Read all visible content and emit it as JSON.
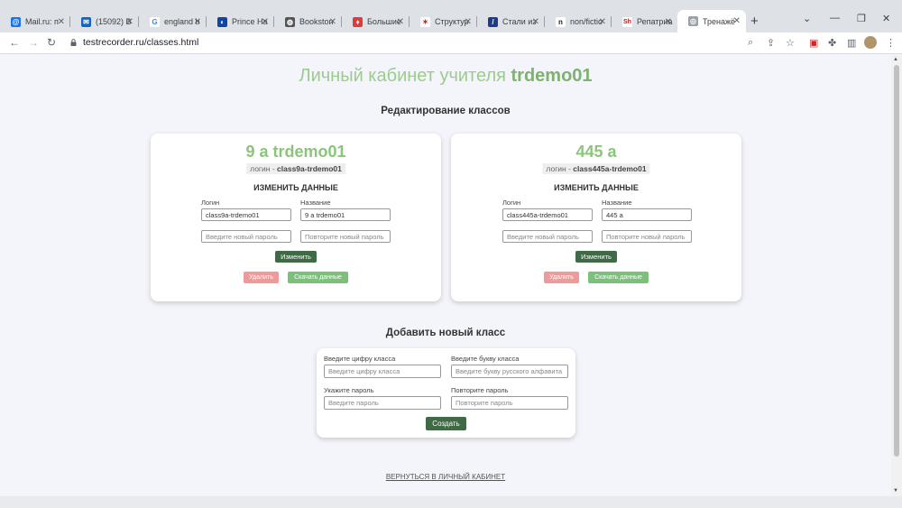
{
  "browser": {
    "tabs": [
      {
        "label": "Mail.ru: п",
        "fav_color": "#1a73e8",
        "fav_char": "@"
      },
      {
        "label": "(15092) В",
        "fav_color": "#1565c0",
        "fav_char": "✉"
      },
      {
        "label": "england b",
        "fav_color": "#ffffff",
        "fav_char": "G"
      },
      {
        "label": "Prince Ha",
        "fav_color": "#0d47a1",
        "fav_char": "◐"
      },
      {
        "label": "Bookston",
        "fav_color": "#555555",
        "fav_char": "◍"
      },
      {
        "label": "Большие",
        "fav_color": "#e53935",
        "fav_char": "♦"
      },
      {
        "label": "Структур",
        "fav_color": "#c62828",
        "fav_char": "✶"
      },
      {
        "label": "Стали из",
        "fav_color": "#1e3a8a",
        "fav_char": "/"
      },
      {
        "label": "non/fictio",
        "fav_color": "#222222",
        "fav_char": "n"
      },
      {
        "label": "Репатриа",
        "fav_color": "#b71c1c",
        "fav_char": "Sh"
      },
      {
        "label": "Тренажё",
        "fav_color": "#9aa0a6",
        "fav_char": "◎"
      }
    ],
    "url": "testrecorder.ru/classes.html"
  },
  "page": {
    "title_prefix": "Личный кабинет учителя",
    "title_user": "trdemo01",
    "edit_heading": "Редактирование классов",
    "add_heading": "Добавить новый класс",
    "back_link": "ВЕРНУТЬСЯ В ЛИЧНЫЙ КАБИНЕТ"
  },
  "classes": [
    {
      "name": "9 а trdemo01",
      "login_prefix": "логин - ",
      "login": "class9a-trdemo01",
      "change_heading": "ИЗМЕНИТЬ ДАННЫЕ",
      "login_label": "Логин",
      "name_label": "Название",
      "login_value": "class9a-trdemo01",
      "name_value": "9 а trdemo01",
      "password_placeholder": "Введите новый пароль",
      "repeat_placeholder": "Повторите новый пароль",
      "change_button": "Изменить",
      "delete_button": "Удалить",
      "download_button": "Скачать данные"
    },
    {
      "name": "445 а",
      "login_prefix": "логин - ",
      "login": "class445a-trdemo01",
      "change_heading": "ИЗМЕНИТЬ ДАННЫЕ",
      "login_label": "Логин",
      "name_label": "Название",
      "login_value": "class445a-trdemo01",
      "name_value": "445 а",
      "password_placeholder": "Введите новый пароль",
      "repeat_placeholder": "Повторите новый пароль",
      "change_button": "Изменить",
      "delete_button": "Удалить",
      "download_button": "Скачать данные"
    }
  ],
  "new_class": {
    "digit_label": "Введите цифру класса",
    "digit_placeholder": "Введите цифру класса",
    "letter_label": "Введите букву класса",
    "letter_placeholder": "Введите букву русского алфавита",
    "password_label": "Укажите пароль",
    "password_placeholder": "Введите пароль",
    "repeat_label": "Повторите пароль",
    "repeat_placeholder": "Повторите пароль",
    "create_button": "Создать"
  }
}
